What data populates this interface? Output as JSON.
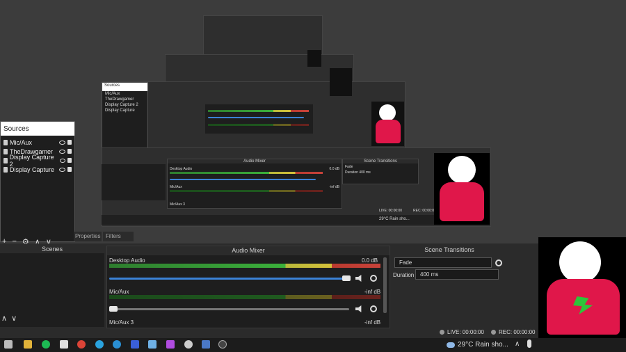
{
  "sources": {
    "title": "Sources",
    "items": [
      "Mic/Aux",
      "TheDrawgamer",
      "Display Capture 2",
      "Display Capture"
    ]
  },
  "dock_tabs": {
    "properties": "Properties",
    "filters": "Filters",
    "scenes": "Scenes"
  },
  "audio_mixer": {
    "title": "Audio Mixer",
    "channels": [
      {
        "name": "Desktop Audio",
        "level": "0.0 dB",
        "volume_fraction": 0.96
      },
      {
        "name": "Mic/Aux",
        "level": "-inf dB",
        "volume_fraction": 0.03
      },
      {
        "name": "Mic/Aux 3",
        "level": "-inf dB",
        "volume_fraction": 0.0
      }
    ],
    "ticks": [
      "-60",
      "-55",
      "-50",
      "-45",
      "-40",
      "-35",
      "-30",
      "-25",
      "-20",
      "-15",
      "-10",
      "-5",
      "0"
    ]
  },
  "scene_transitions": {
    "title": "Scene Transitions",
    "transition": "Fade",
    "duration_label": "Duration",
    "duration": "400 ms"
  },
  "status": {
    "live": "LIVE: 00:00:00",
    "rec": "REC: 00:00:00"
  },
  "taskbar": {
    "weather": "29°C  Rain sho..."
  },
  "nested": {
    "mixer_title": "Audio Mixer",
    "transitions_title": "Scene Transitions",
    "desktop": "Desktop Audio",
    "mic": "Mic/Aux",
    "mic3": "Mic/Aux 3",
    "fade": "Fade",
    "duration": "Duration",
    "duration_value": "400 ms",
    "level0": "0.0 dB",
    "levelinf": "-inf dB",
    "live": "LIVE: 00:00:00",
    "rec": "REC: 00:00:00",
    "weather": "29°C  Rain sho...",
    "sources_title": "Sources",
    "src": [
      "Mic/Aux",
      "TheDrawgamer",
      "Display Capture 2",
      "Display Capture"
    ]
  }
}
